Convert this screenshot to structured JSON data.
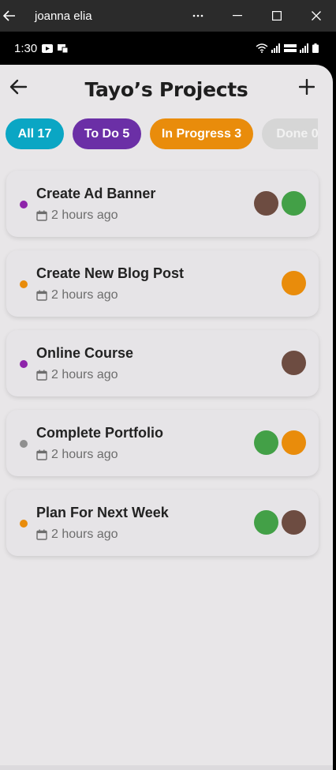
{
  "window": {
    "title": "joanna elia",
    "back_icon": "arrow-left-icon",
    "controls": [
      "more-icon",
      "minimize-icon",
      "maximize-icon",
      "close-icon"
    ]
  },
  "status_bar": {
    "time": "1:30"
  },
  "header": {
    "title": "Tayo’s Projects",
    "back_icon": "arrow-left-icon",
    "add_icon": "plus-icon"
  },
  "filters": [
    {
      "label": "All 17",
      "color": "#0aa6c4"
    },
    {
      "label": "To Do 5",
      "color": "#6b2fa6"
    },
    {
      "label": "In Progress 3",
      "color": "#e98c0b"
    },
    {
      "label": "Done 0",
      "color": "#d6d6d6"
    }
  ],
  "colors": {
    "todo": "#8e24aa",
    "in_progress": "#e98c0b",
    "done": "#8f8f8f",
    "avatar_brown": "#6d4c41",
    "avatar_green": "#43a047",
    "avatar_orange": "#e98c0b"
  },
  "projects": [
    {
      "title": "Create Ad Banner",
      "time": "2 hours ago",
      "status_color": "#8e24aa",
      "avatars": [
        "#6d4c41",
        "#43a047"
      ]
    },
    {
      "title": "Create New Blog Post",
      "time": "2 hours ago",
      "status_color": "#e98c0b",
      "avatars": [
        "#e98c0b"
      ]
    },
    {
      "title": "Online Course",
      "time": "2 hours ago",
      "status_color": "#8e24aa",
      "avatars": [
        "#6d4c41"
      ]
    },
    {
      "title": "Complete Portfolio",
      "time": "2 hours ago",
      "status_color": "#8f8f8f",
      "avatars": [
        "#43a047",
        "#e98c0b"
      ]
    },
    {
      "title": "Plan For Next Week",
      "time": "2 hours ago",
      "status_color": "#e98c0b",
      "avatars": [
        "#43a047",
        "#6d4c41"
      ]
    }
  ]
}
